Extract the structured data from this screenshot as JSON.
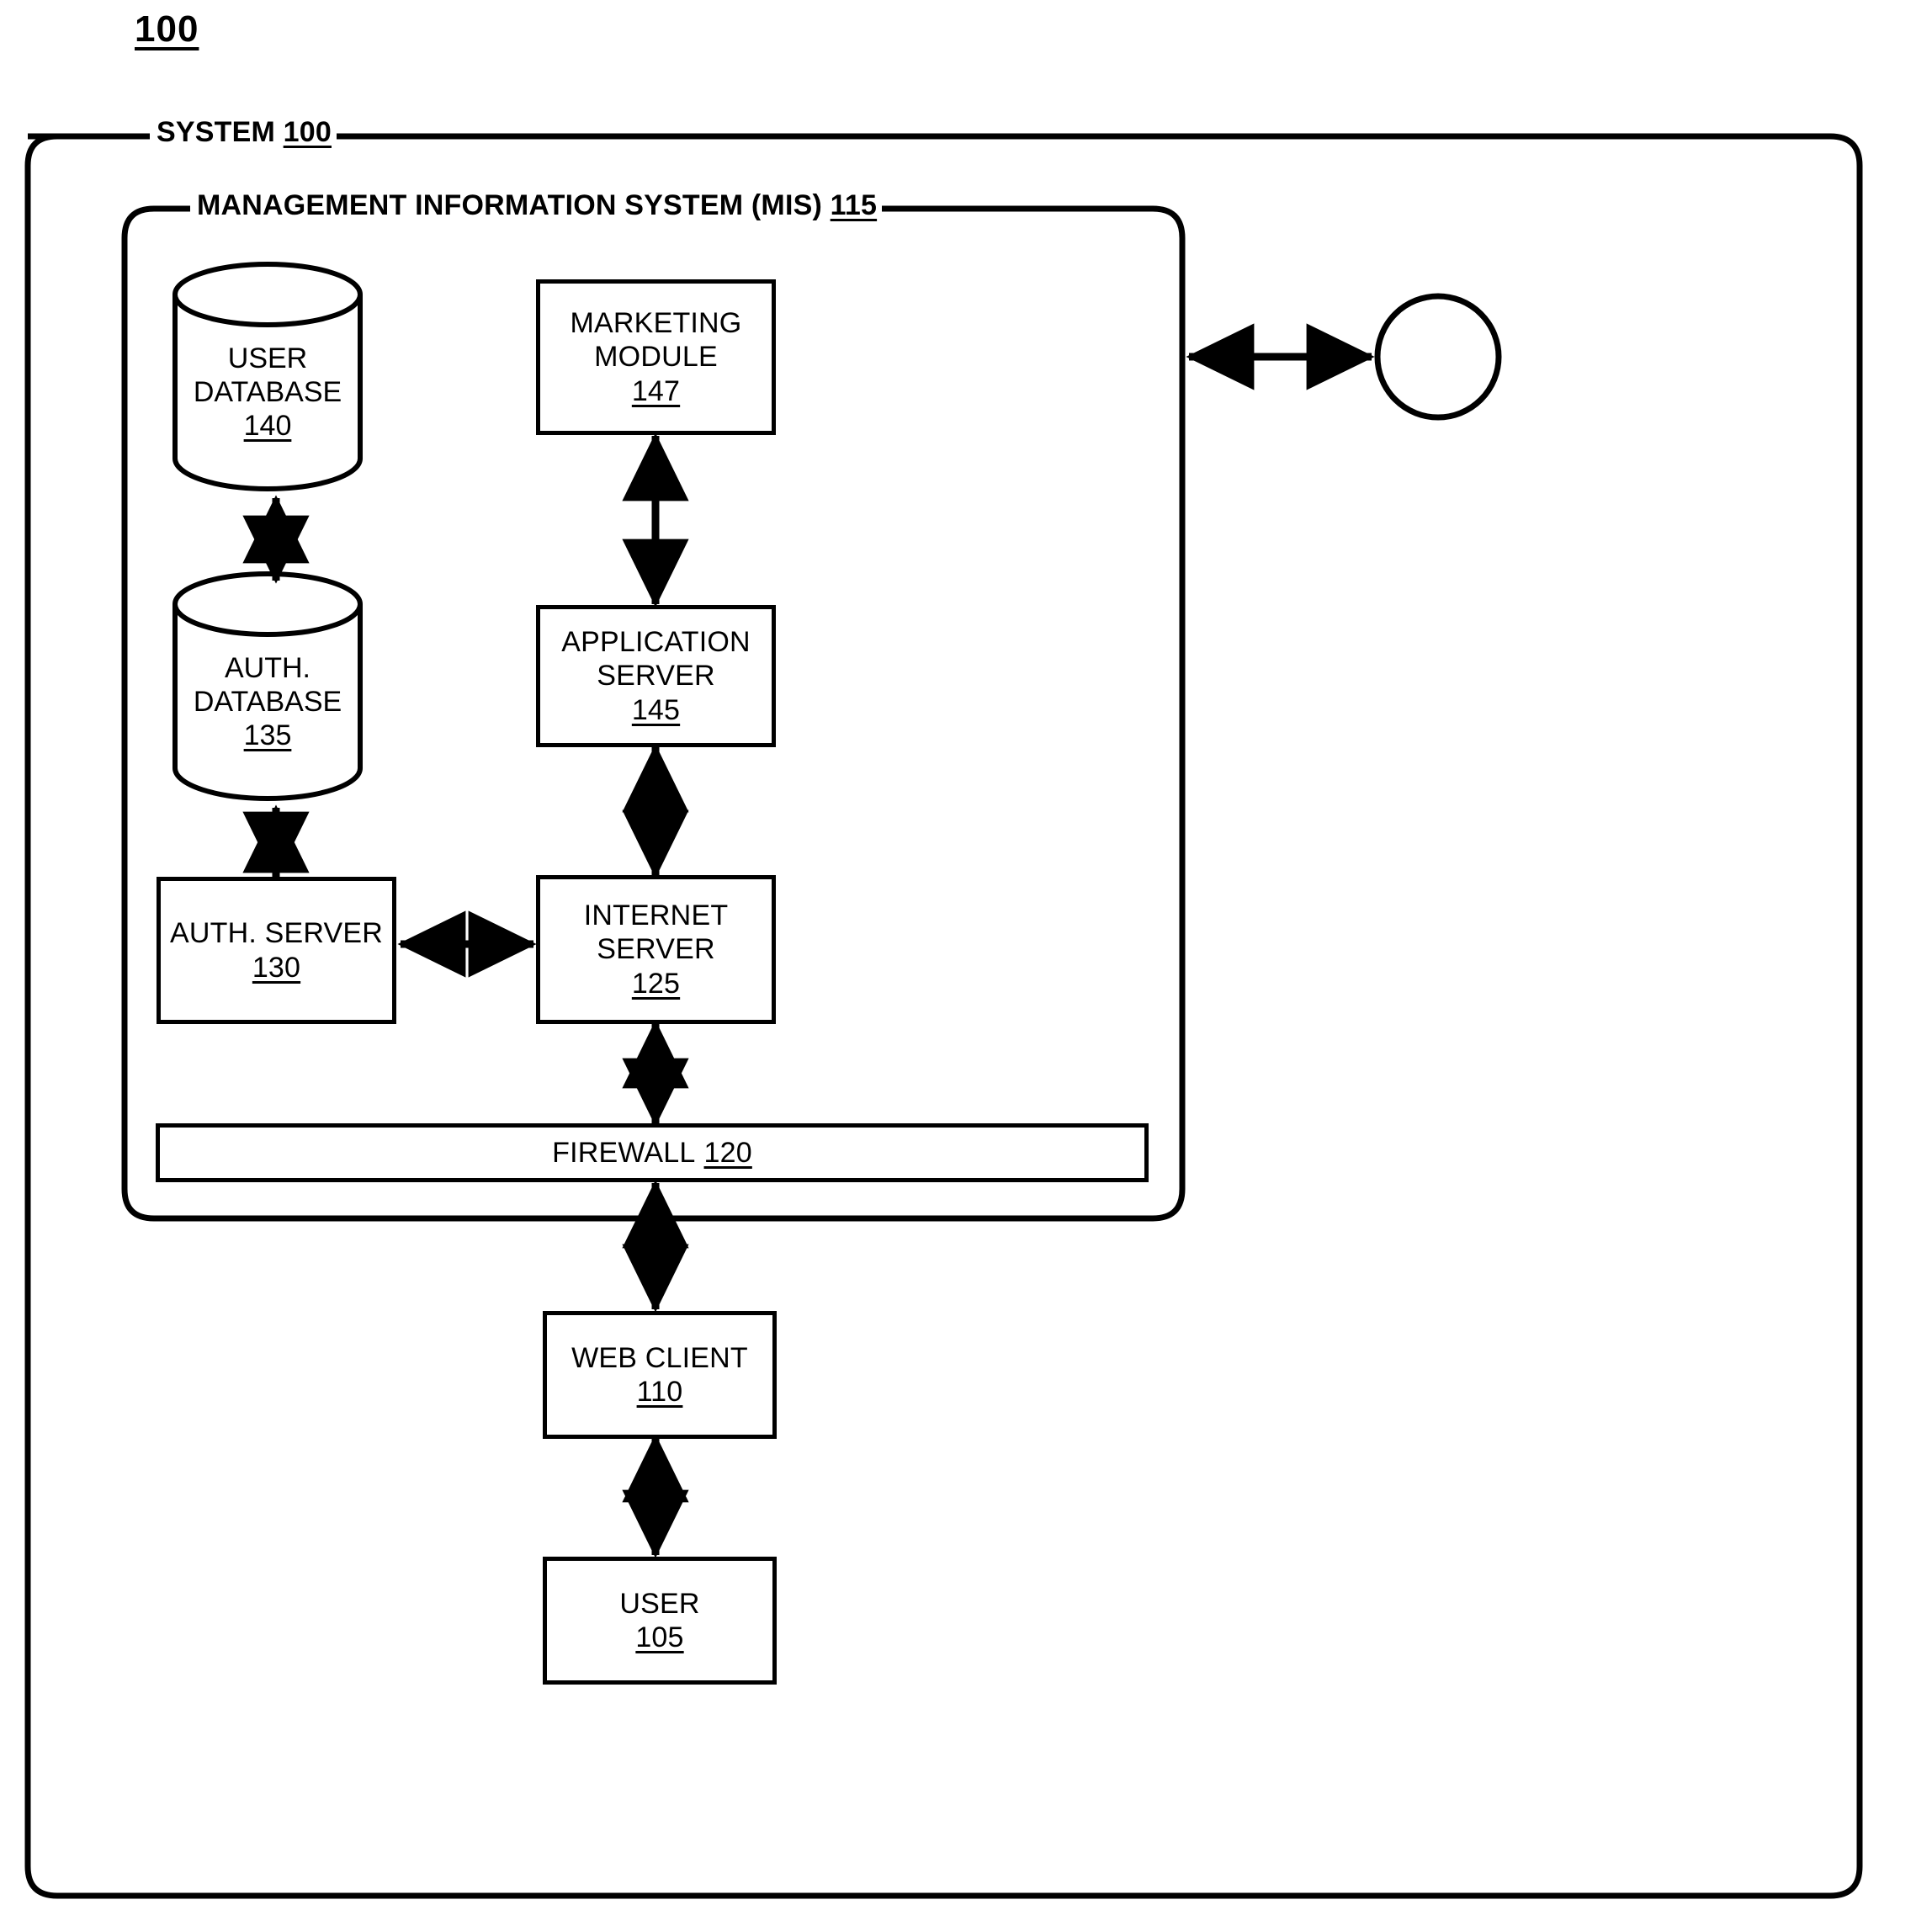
{
  "figure": {
    "number": "100"
  },
  "boundaries": {
    "system": {
      "label": "SYSTEM 100",
      "label_text": "SYSTEM ",
      "label_ref": "100"
    },
    "mis": {
      "label": "MANAGEMENT INFORMATION SYSTEM (MIS) 115",
      "label_text": "MANAGEMENT INFORMATION SYSTEM (MIS) ",
      "label_ref": "115"
    }
  },
  "nodes": {
    "user_database": {
      "line1": "USER",
      "line2": "DATABASE",
      "ref": "140",
      "shape": "cylinder"
    },
    "auth_database": {
      "line1": "AUTH.",
      "line2": "DATABASE",
      "ref": "135",
      "shape": "cylinder"
    },
    "marketing_module": {
      "line1": "MARKETING",
      "line2": "MODULE",
      "ref": "147",
      "shape": "rect"
    },
    "application_server": {
      "line1": "APPLICATION",
      "line2": "SERVER",
      "ref": "145",
      "shape": "rect"
    },
    "auth_server": {
      "line1": "AUTH. SERVER",
      "line2": "",
      "ref": "130",
      "shape": "rect"
    },
    "internet_server": {
      "line1": "INTERNET",
      "line2": "SERVER",
      "ref": "125",
      "shape": "rect"
    },
    "firewall": {
      "line1": "FIREWALL",
      "ref": "120",
      "shape": "bar"
    },
    "web_client": {
      "line1": "WEB CLIENT",
      "line2": "",
      "ref": "110",
      "shape": "rect"
    },
    "user": {
      "line1": "USER",
      "line2": "",
      "ref": "105",
      "shape": "rect"
    },
    "network_node": {
      "line1": "",
      "ref": "",
      "shape": "circle"
    }
  },
  "connections": [
    {
      "from": "user_database",
      "to": "auth_database",
      "type": "bidirectional"
    },
    {
      "from": "auth_database",
      "to": "auth_server",
      "type": "bidirectional"
    },
    {
      "from": "marketing_module",
      "to": "application_server",
      "type": "bidirectional"
    },
    {
      "from": "application_server",
      "to": "internet_server",
      "type": "bidirectional"
    },
    {
      "from": "auth_server",
      "to": "internet_server",
      "type": "bidirectional"
    },
    {
      "from": "internet_server",
      "to": "firewall",
      "type": "bidirectional"
    },
    {
      "from": "firewall",
      "to": "web_client",
      "type": "bidirectional"
    },
    {
      "from": "web_client",
      "to": "user",
      "type": "bidirectional"
    },
    {
      "from": "mis",
      "to": "network_node",
      "type": "bidirectional"
    }
  ],
  "colors": {
    "stroke": "#000000",
    "background": "#ffffff"
  }
}
